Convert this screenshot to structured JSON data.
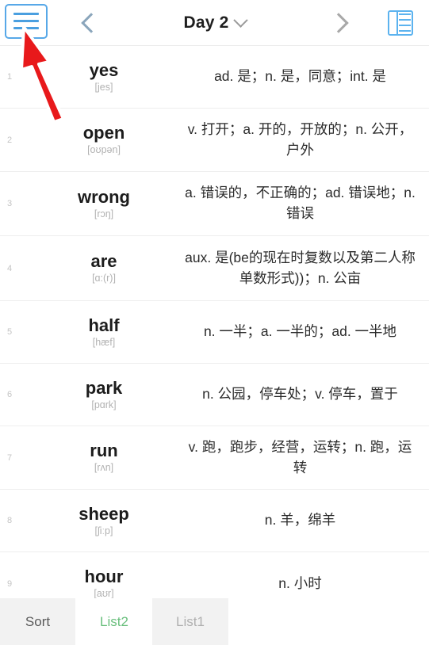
{
  "topbar": {
    "menu_icon": "hamburger-menu-icon",
    "prev_icon": "chevron-left-icon",
    "title": "Day 2",
    "title_dropdown_icon": "chevron-down-icon",
    "next_icon": "chevron-right-icon",
    "grid_icon": "table-view-icon",
    "accent_blue": "#4a9fe0",
    "prev_color": "#8aa5bb",
    "next_color": "#a8a8a8"
  },
  "annotation": {
    "arrow_icon": "red-arrow-up-left",
    "arrow_color": "#e8191b",
    "arrow_outline": "#ffffff"
  },
  "list": {
    "rows": [
      {
        "index": "1",
        "word": "yes",
        "ipa": "[jes]",
        "definition": "ad. 是；n. 是，同意；int. 是"
      },
      {
        "index": "2",
        "word": "open",
        "ipa": "[oʊpən]",
        "definition": "v. 打开；a. 开的，开放的；n. 公开，户外"
      },
      {
        "index": "3",
        "word": "wrong",
        "ipa": "[rɔŋ]",
        "definition": "a. 错误的，不正确的；ad. 错误地；n. 错误"
      },
      {
        "index": "4",
        "word": "are",
        "ipa": "[ɑ:(r)]",
        "definition": "aux. 是(be的现在时复数以及第二人称单数形式))；n. 公亩"
      },
      {
        "index": "5",
        "word": "half",
        "ipa": "[hæf]",
        "definition": "n. 一半；a. 一半的；ad. 一半地"
      },
      {
        "index": "6",
        "word": "park",
        "ipa": "[pɑrk]",
        "definition": "n. 公园，停车处；v. 停车，置于"
      },
      {
        "index": "7",
        "word": "run",
        "ipa": "[rʌn]",
        "definition": "v. 跑，跑步，经营，运转；n. 跑，运转"
      },
      {
        "index": "8",
        "word": "sheep",
        "ipa": "[ʃiːp]",
        "definition": "n. 羊，绵羊"
      },
      {
        "index": "9",
        "word": "hour",
        "ipa": "[aʊr]",
        "definition": "n. 小时"
      }
    ]
  },
  "tabbar": {
    "tabs": [
      {
        "label": "Sort",
        "state": "inactive"
      },
      {
        "label": "List2",
        "state": "active"
      },
      {
        "label": "List1",
        "state": "inactive"
      }
    ],
    "active_color": "#6abf7d"
  }
}
